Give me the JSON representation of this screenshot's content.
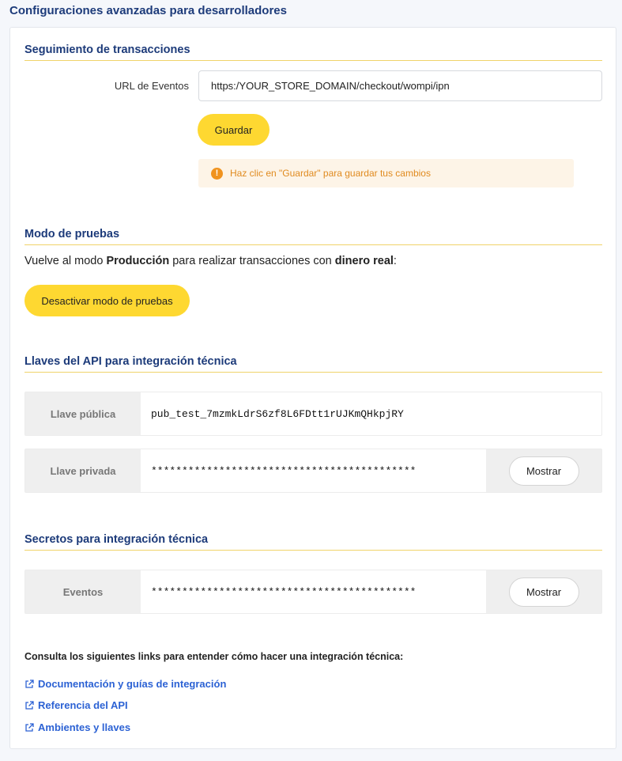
{
  "page": {
    "title": "Configuraciones avanzadas para desarrolladores"
  },
  "tracking": {
    "title": "Seguimiento de transacciones",
    "url_label": "URL de Eventos",
    "url_value": "https:/YOUR_STORE_DOMAIN/checkout/wompi/ipn",
    "save_label": "Guardar",
    "notice_text": "Haz clic en \"Guardar\" para guardar tus cambios",
    "notice_icon": "!"
  },
  "test_mode": {
    "title": "Modo de pruebas",
    "text_1": "Vuelve al modo ",
    "text_bold_1": "Producción",
    "text_2": " para realizar transacciones con ",
    "text_bold_2": "dinero real",
    "text_3": ":",
    "button_label": "Desactivar modo de pruebas"
  },
  "api_keys": {
    "title": "Llaves del API para integración técnica",
    "public_label": "Llave pública",
    "public_value": "pub_test_7mzmkLdrS6zf8L6FDtt1rUJKmQHkpjRY",
    "private_label": "Llave privada",
    "private_value": "*******************************************",
    "show_label": "Mostrar"
  },
  "secrets": {
    "title": "Secretos para integración técnica",
    "events_label": "Eventos",
    "events_value": "*******************************************",
    "show_label": "Mostrar"
  },
  "links": {
    "intro": "Consulta los siguientes links para entender cómo hacer una integración técnica:",
    "items": [
      {
        "label": "Documentación y guías de integración",
        "icon": "external-link-icon"
      },
      {
        "label": "Referencia del API",
        "icon": "external-link-icon"
      },
      {
        "label": "Ambientes y llaves",
        "icon": "external-link-icon"
      }
    ]
  },
  "colors": {
    "accent_yellow": "#fed831",
    "title_blue": "#1d3b7a",
    "link_blue": "#2c62d4",
    "notice_orange": "#f0931f"
  }
}
